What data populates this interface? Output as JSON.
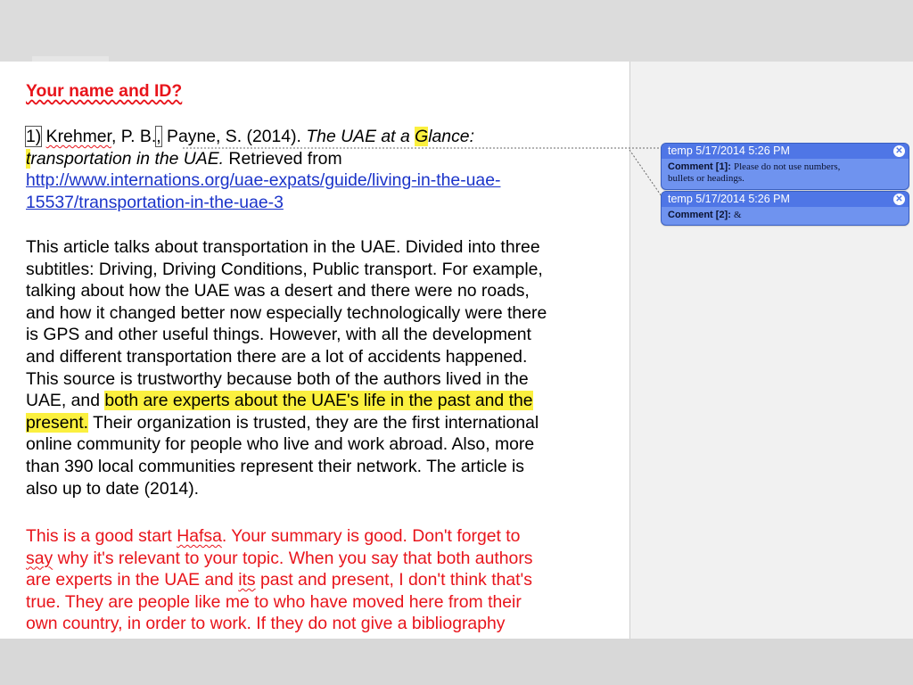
{
  "document": {
    "title": "Your name and ID?",
    "citation": {
      "number": "1)",
      "author1": "Krehmer",
      "author1_rest": ", P. B.",
      "comma": ",",
      "author2": " Payne, S. (2014). ",
      "title_pre": "The UAE at a ",
      "title_hl": "G",
      "title_post": "lance:",
      "title2_hl": "t",
      "title2_post": "ransportation in the UAE.",
      "retrieved": " Retrieved from",
      "url_line1": "http://www.internations.org/uae-expats/guide/living-in-the-uae-",
      "url_line2": "15537/transportation-in-the-uae-3"
    },
    "summary": {
      "lines": [
        "This article talks about transportation in the UAE. Divided into three",
        "subtitles: Driving, Driving Conditions, Public transport. For example,",
        "talking about how the UAE was a desert and there were no roads,",
        "and how it changed better now especially technologically were there",
        "is GPS and other useful things. However, with all the development",
        "and different transportation there are a lot of accidents happened.",
        "This source is trustworthy because both of the authors lived in the"
      ],
      "line8_pre": "UAE, and ",
      "line8_hl": "both are experts about the UAE's life in the past and the",
      "line9_hl": "present.",
      "line9_post": " Their organization is trusted, they are the first international",
      "lines_after": [
        "online community for people who live and work abroad. Also, more",
        "than 390 local communities represent their network. The article is",
        "also up to date (2014)."
      ]
    },
    "feedback": {
      "l1_pre": "This is a good start ",
      "l1_sp": "Hafsa",
      "l1_post": ".  Your summary is good.  Don't forget to",
      "l2_sp": "say",
      "l2_post": " why it's relevant to your topic.  When you say that both authors",
      "l3_pre": "are experts in the UAE and ",
      "l3_sp": "its",
      "l3_post": " past and present, I don't think that's",
      "l4": "true.  They are people like me to who have moved here from their",
      "l5": "own country, in order to work.  If they do not give a bibliography"
    }
  },
  "comments": [
    {
      "header": "temp 5/17/2014 5:26 PM",
      "label": "Comment [1]:",
      "text": "Please do not use numbers,",
      "text2": "bullets or headings."
    },
    {
      "header": "temp 5/17/2014 5:26 PM",
      "label": "Comment [2]:",
      "text": "&"
    }
  ],
  "colors": {
    "comment_bg": "#6f93ef",
    "comment_header": "#4f76e6",
    "highlight": "#fbf03f",
    "feedback_red": "#e8141b",
    "link_blue": "#1a33c9"
  },
  "icons": {
    "close": "close-icon"
  }
}
